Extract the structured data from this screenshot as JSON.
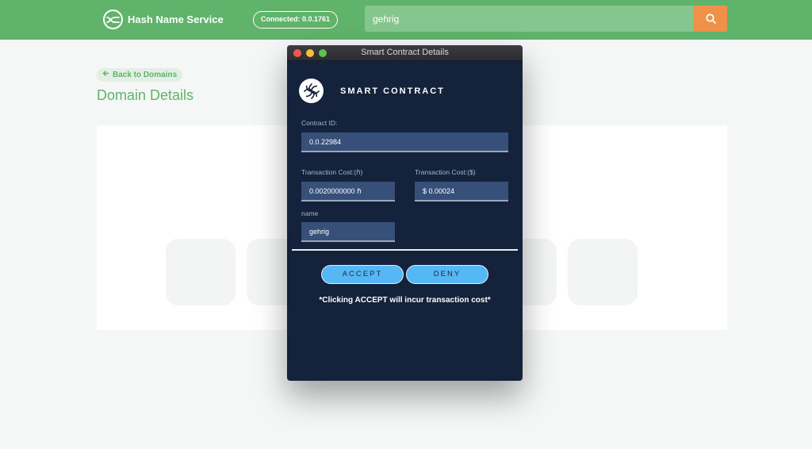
{
  "header": {
    "brand_title": "Hash Name Service",
    "connected_label": "Connected: 0.0.1761",
    "search_value": "gehrig",
    "colors": {
      "bar": "#5fb36a",
      "search_button": "#f0914a"
    }
  },
  "page": {
    "back_label": "Back to Domains",
    "title": "Domain Details"
  },
  "modal": {
    "window_title": "Smart Contract Details",
    "heading": "SMART CONTRACT",
    "contract_id_label": "Contract ID:",
    "contract_id_value": "0.0.22984",
    "cost_hbar_label": "Transaction Cost:(ℏ)",
    "cost_hbar_value": "0.0020000000 ℏ",
    "cost_usd_label": "Transaction Cost:($)",
    "cost_usd_value": "$ 0.00024",
    "name_label": "name",
    "name_value": "gehrig",
    "accept_label": "ACCEPT",
    "deny_label": "DENY",
    "note": "*Clicking ACCEPT will incur transaction cost*",
    "colors": {
      "background": "#14223b",
      "field": "#36507a",
      "button": "#55b8f5"
    }
  }
}
